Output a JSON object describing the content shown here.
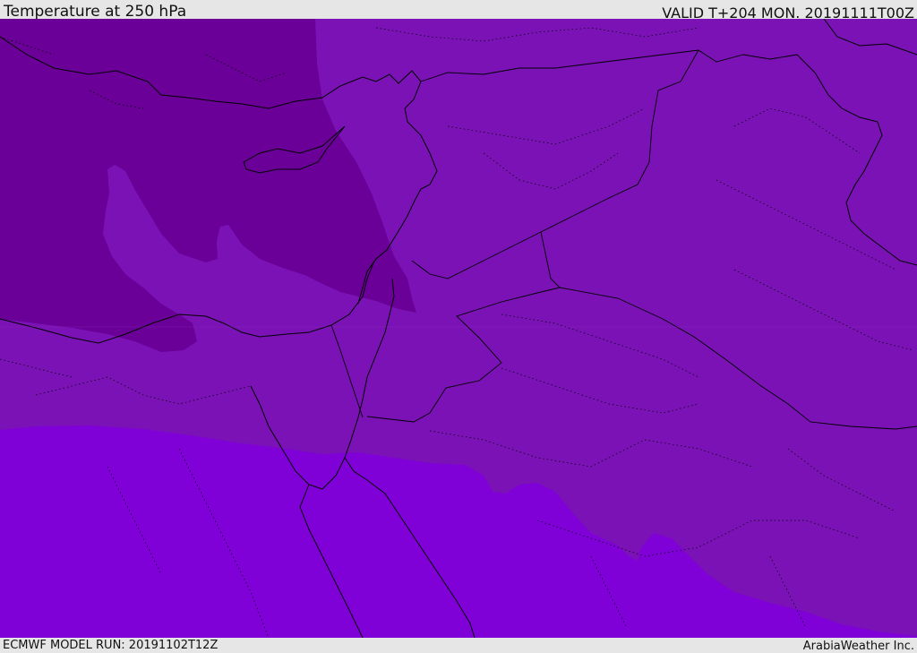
{
  "header": {
    "title": "Temperature at 250 hPa",
    "valid_time": "VALID T+204 MON. 20191111T00Z"
  },
  "footer": {
    "model_run": "ECMWF MODEL RUN: 20191102T12Z",
    "credit": "ArabiaWeather Inc."
  },
  "map": {
    "colors": {
      "coldest_band": "#6a0097",
      "mid_band": "#7a12b5",
      "warm_band": "#8000d8",
      "coastline": "#000000",
      "border": "#000000"
    }
  }
}
